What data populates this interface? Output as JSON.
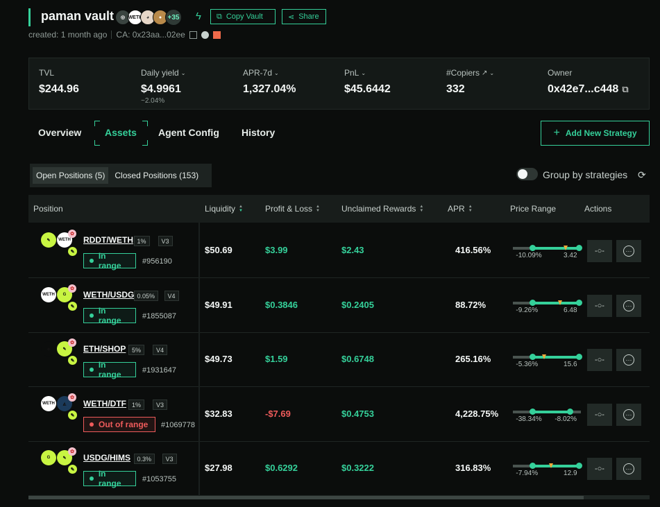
{
  "vault": {
    "title": "paman vault",
    "avatar_count": "+35",
    "copy_label": "Copy Vault",
    "share_label": "Share",
    "created": "created: 1 month ago",
    "ca": "CA: 0x23aa...02ee"
  },
  "stats": {
    "tvl_label": "TVL",
    "tvl": "$244.96",
    "yield_label": "Daily yield",
    "yield": "$4.9961",
    "yield_sub": "~2.04%",
    "apr_label": "APR-7d",
    "apr": "1,327.04%",
    "pnl_label": "PnL",
    "pnl": "$45.6442",
    "copiers_label": "#Copiers",
    "copiers": "332",
    "owner_label": "Owner",
    "owner": "0x42e7...c448"
  },
  "tabs": [
    "Overview",
    "Assets",
    "Agent Config",
    "History"
  ],
  "add_strategy_label": "Add New Strategy",
  "subtabs": [
    "Open Positions (5)",
    "Closed Positions (153)"
  ],
  "group_label": "Group by strategies",
  "columns": [
    "Position",
    "Liquidity",
    "Profit & Loss",
    "Unclaimed Rewards",
    "APR",
    "Price Range",
    "Actions"
  ],
  "positions": [
    {
      "pair": "RDDT/WETH",
      "fee": "1%",
      "ver": "V3",
      "status": "In range",
      "nft": "#956190",
      "liquidity": "$50.69",
      "pnl": "$3.99",
      "rewards": "$2.43",
      "apr": "416.56%",
      "rmin": "-10.09%",
      "rmax": "3.42",
      "fill": [
        0.29,
        0.97
      ],
      "mark": 0.78
    },
    {
      "pair": "WETH/USDG",
      "fee": "0.05%",
      "ver": "V4",
      "status": "In range",
      "nft": "#1855087",
      "liquidity": "$49.91",
      "pnl": "$0.3846",
      "rewards": "$0.2405",
      "apr": "88.72%",
      "rmin": "-9.26%",
      "rmax": "6.48",
      "fill": [
        0.29,
        0.97
      ],
      "mark": 0.69
    },
    {
      "pair": "ETH/SHOP",
      "fee": "5%",
      "ver": "V4",
      "status": "In range",
      "nft": "#1931647",
      "liquidity": "$49.73",
      "pnl": "$1.59",
      "rewards": "$0.6748",
      "apr": "265.16%",
      "rmin": "-5.36%",
      "rmax": "15.6",
      "fill": [
        0.29,
        0.97
      ],
      "mark": 0.46
    },
    {
      "pair": "WETH/DTF",
      "fee": "1%",
      "ver": "V3",
      "status": "Out of range",
      "nft": "#1069778",
      "liquidity": "$32.83",
      "pnl": "-$7.69",
      "rewards": "$0.4753",
      "apr": "4,228.75%",
      "rmin": "-38.34%",
      "rmax": "-8.02%",
      "fill": [
        0.29,
        0.84
      ],
      "mark": null
    },
    {
      "pair": "USDG/HIMS",
      "fee": "0.3%",
      "ver": "V3",
      "status": "In range",
      "nft": "#1053755",
      "liquidity": "$27.98",
      "pnl": "$0.6292",
      "rewards": "$0.3222",
      "apr": "316.83%",
      "rmin": "-7.94%",
      "rmax": "12.9",
      "fill": [
        0.29,
        0.97
      ],
      "mark": 0.56
    }
  ]
}
